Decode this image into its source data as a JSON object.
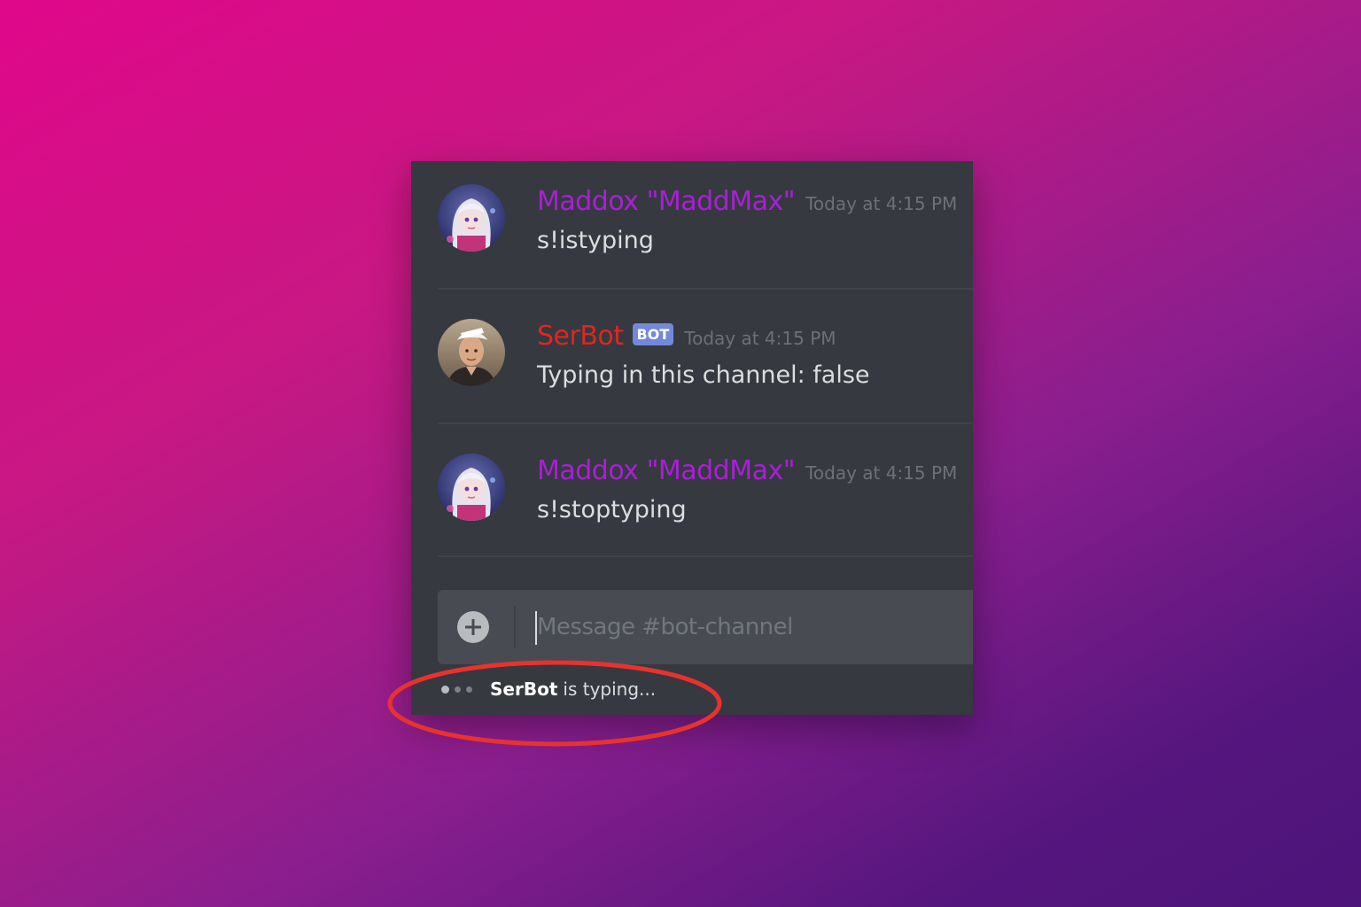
{
  "colors": {
    "panel_bg": "#36393f",
    "username_maddox": "#a91fd7",
    "username_serbot": "#e0261e",
    "bot_tag": "#7289da",
    "timestamp": "#6d7076",
    "message_text": "#dcddde",
    "highlight_ring": "#e8322e"
  },
  "messages": [
    {
      "author": "Maddox \"MaddMax\"",
      "timestamp": "Today at 4:15 PM",
      "content": "s!istyping",
      "avatar": "anime-girl-avatar"
    },
    {
      "author": "SerBot",
      "bot_tag": "BOT",
      "timestamp": "Today at 4:15 PM",
      "content": "Typing in this channel: false",
      "avatar": "man-photo-avatar"
    },
    {
      "author": "Maddox \"MaddMax\"",
      "timestamp": "Today at 4:15 PM",
      "content": "s!stoptyping",
      "avatar": "anime-girl-avatar"
    }
  ],
  "composer": {
    "placeholder": "Message #bot-channel",
    "value": "",
    "upload_icon": "plus-circle-icon"
  },
  "typing_indicator": {
    "name": "SerBot",
    "text": "is typing..."
  }
}
